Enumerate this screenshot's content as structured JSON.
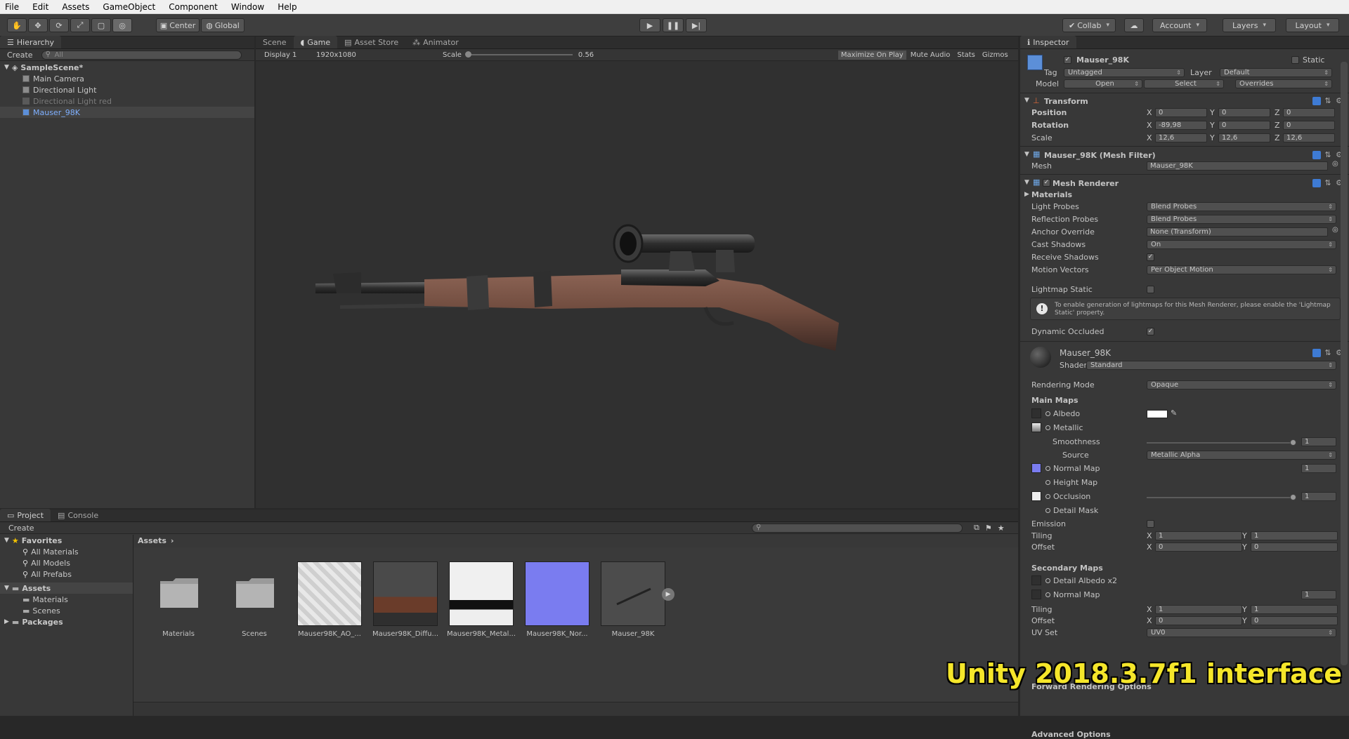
{
  "menu": [
    "File",
    "Edit",
    "Assets",
    "GameObject",
    "Component",
    "Window",
    "Help"
  ],
  "toolbar": {
    "center": "Center",
    "global": "Global",
    "collab": "Collab",
    "account": "Account",
    "layers": "Layers",
    "layout": "Layout"
  },
  "hierarchy": {
    "tab": "Hierarchy",
    "create": "Create",
    "search": "All",
    "scene": "SampleScene*",
    "items": [
      "Main Camera",
      "Directional Light",
      "Directional Light red",
      "Mauser_98K"
    ]
  },
  "view": {
    "tabs": [
      "Scene",
      "Game",
      "Asset Store",
      "Animator"
    ],
    "display": "Display 1",
    "resolution": "1920x1080",
    "scale_label": "Scale",
    "scale_value": "0.56",
    "buttons": [
      "Maximize On Play",
      "Mute Audio",
      "Stats",
      "Gizmos"
    ]
  },
  "inspector": {
    "tab": "Inspector",
    "name": "Mauser_98K",
    "static": "Static",
    "tag_label": "Tag",
    "tag": "Untagged",
    "layer_label": "Layer",
    "layer": "Default",
    "model_label": "Model",
    "open": "Open",
    "select": "Select",
    "overrides": "Overrides",
    "transform": {
      "title": "Transform",
      "position": "Position",
      "rotation": "Rotation",
      "scale": "Scale",
      "pos": [
        "0",
        "0",
        "0"
      ],
      "rot": [
        "-89,98",
        "0",
        "0"
      ],
      "scl": [
        "12,6",
        "12,6",
        "12,6"
      ]
    },
    "meshfilter": {
      "title": "Mauser_98K (Mesh Filter)",
      "mesh_label": "Mesh",
      "mesh": "Mauser_98K"
    },
    "renderer": {
      "title": "Mesh Renderer",
      "materials": "Materials",
      "light_probes": "Light Probes",
      "light_probes_v": "Blend Probes",
      "refl_probes": "Reflection Probes",
      "refl_probes_v": "Blend Probes",
      "anchor": "Anchor Override",
      "anchor_v": "None (Transform)",
      "cast": "Cast Shadows",
      "cast_v": "On",
      "receive": "Receive Shadows",
      "motion": "Motion Vectors",
      "motion_v": "Per Object Motion",
      "lightmap": "Lightmap Static",
      "info": "To enable generation of lightmaps for this Mesh Renderer, please enable the 'Lightmap Static' property.",
      "dyn": "Dynamic Occluded"
    },
    "material": {
      "name": "Mauser_98K",
      "shader_label": "Shader",
      "shader": "Standard",
      "rendering_mode": "Rendering Mode",
      "rendering_mode_v": "Opaque",
      "main_maps": "Main Maps",
      "albedo": "Albedo",
      "metallic": "Metallic",
      "smoothness": "Smoothness",
      "smoothness_v": "1",
      "source": "Source",
      "source_v": "Metallic Alpha",
      "normal": "Normal Map",
      "normal_v": "1",
      "height": "Height Map",
      "occlusion": "Occlusion",
      "occlusion_v": "1",
      "detail_mask": "Detail Mask",
      "emission": "Emission",
      "tiling": "Tiling",
      "offset": "Offset",
      "tiling_x": "1",
      "tiling_y": "1",
      "offset_x": "0",
      "offset_y": "0",
      "secondary": "Secondary Maps",
      "detail_albedo": "Detail Albedo x2",
      "sec_normal": "Normal Map",
      "sec_normal_v": "1",
      "tiling2_x": "1",
      "tiling2_y": "1",
      "offset2_x": "0",
      "offset2_y": "0",
      "uvset": "UV Set",
      "uvset_v": "UV0",
      "forward": "Forward Rendering Options",
      "advanced": "Advanced Options"
    }
  },
  "project": {
    "tabs": [
      "Project",
      "Console"
    ],
    "create": "Create",
    "favorites": "Favorites",
    "fav_items": [
      "All Materials",
      "All Models",
      "All Prefabs"
    ],
    "assets": "Assets",
    "asset_folders": [
      "Materials",
      "Scenes"
    ],
    "packages": "Packages",
    "breadcrumb": "Assets",
    "items": [
      "Materials",
      "Scenes",
      "Mauser98K_AO_...",
      "Mauser98K_Diffu...",
      "Mauser98K_Metal...",
      "Mauser98K_Nor...",
      "Mauser_98K"
    ]
  },
  "watermark": "Unity 2018.3.7f1 interface",
  "colors": {
    "accent": "#3e7bd4",
    "watermark": "#f5e62a",
    "normal_map": "#7a7cf0"
  }
}
